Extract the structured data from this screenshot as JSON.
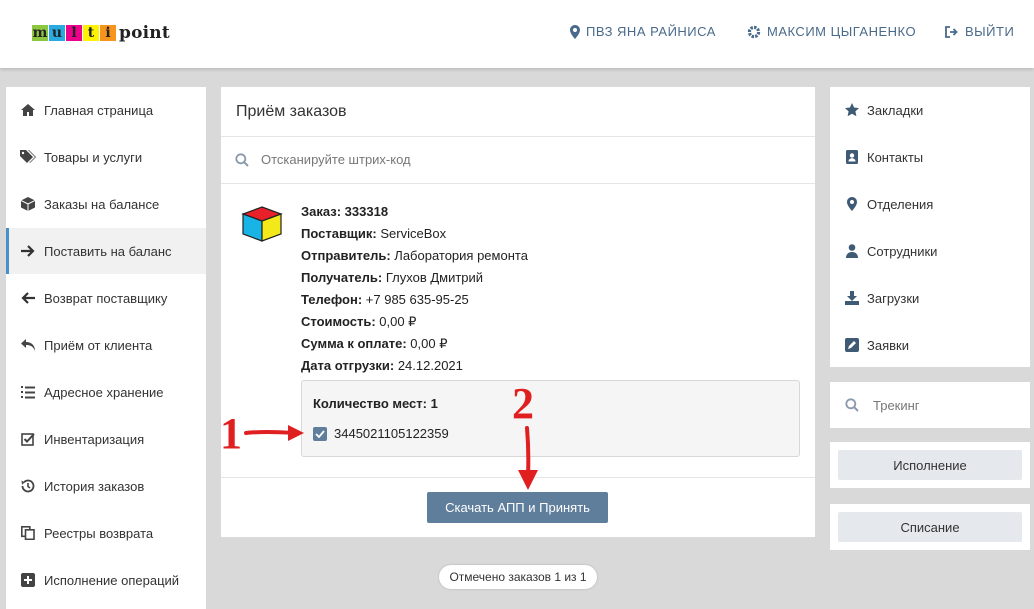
{
  "header": {
    "logo": {
      "letters": [
        "m",
        "u",
        "l",
        "t",
        "i"
      ],
      "letter_colors": [
        "#8dc63f",
        "#29abe2",
        "#ec008c",
        "#fff200",
        "#f7941d"
      ],
      "rest": "point"
    },
    "nav": [
      {
        "label": "ПВЗ ЯНА РАЙНИСА",
        "icon": "map-marker-icon"
      },
      {
        "label": "МАКСИМ ЦЫГАНЕНКО",
        "icon": "gear-icon"
      },
      {
        "label": "ВЫЙТИ",
        "icon": "sign-out-icon"
      }
    ]
  },
  "sidebar": {
    "items": [
      {
        "label": "Главная страница",
        "icon": "home-icon"
      },
      {
        "label": "Товары и услуги",
        "icon": "tags-icon"
      },
      {
        "label": "Заказы на балансе",
        "icon": "cube-icon"
      },
      {
        "label": "Поставить на баланс",
        "icon": "arrow-right-icon",
        "active": true
      },
      {
        "label": "Возврат поставщику",
        "icon": "arrow-left-icon"
      },
      {
        "label": "Приём от клиента",
        "icon": "reply-icon"
      },
      {
        "label": "Адресное хранение",
        "icon": "list-ol-icon"
      },
      {
        "label": "Инвентаризация",
        "icon": "check-square-icon"
      },
      {
        "label": "История заказов",
        "icon": "history-icon"
      },
      {
        "label": "Реестры возврата",
        "icon": "copy-icon"
      },
      {
        "label": "Исполнение операций",
        "icon": "plus-square-icon"
      }
    ]
  },
  "main": {
    "title": "Приём заказов",
    "search_placeholder": "Отсканируйте штрих-код",
    "order": {
      "fields": [
        {
          "label": "Заказ:",
          "value": " 333318",
          "bold_value": true
        },
        {
          "label": "Поставщик:",
          "value": " ServiceBox"
        },
        {
          "label": "Отправитель:",
          "value": " Лаборатория ремонта"
        },
        {
          "label": "Получатель:",
          "value": " Глухов Дмитрий"
        },
        {
          "label": "Телефон:",
          "value": " +7 985 635-95-25"
        },
        {
          "label": "Стоимость:",
          "value": " 0,00 ₽"
        },
        {
          "label": "Сумма к оплате:",
          "value": " 0,00 ₽"
        },
        {
          "label": "Дата отгрузки:",
          "value": " 24.12.2021"
        }
      ],
      "places_title": "Количество мест: 1",
      "place_barcode": "3445021105122359",
      "place_checked": true
    },
    "accept_button": "Скачать АПП и Принять",
    "counter": "Отмечено заказов 1 из 1"
  },
  "rightbar": {
    "items": [
      {
        "label": "Закладки",
        "icon": "star-icon"
      },
      {
        "label": "Контакты",
        "icon": "address-book-icon"
      },
      {
        "label": "Отделения",
        "icon": "map-marker-icon"
      },
      {
        "label": "Сотрудники",
        "icon": "user-icon"
      },
      {
        "label": "Загрузки",
        "icon": "download-icon"
      },
      {
        "label": "Заявки",
        "icon": "edit-icon"
      }
    ],
    "tracking_placeholder": "Трекинг",
    "execution_button": "Исполнение",
    "writeoff_button": "Списание"
  },
  "annotations": {
    "one": "1",
    "two": "2",
    "color": "#e02020"
  },
  "colors": {
    "accent": "#5f7e9c",
    "nav_text": "#4a6a8a",
    "active_border": "#4a90c8"
  }
}
